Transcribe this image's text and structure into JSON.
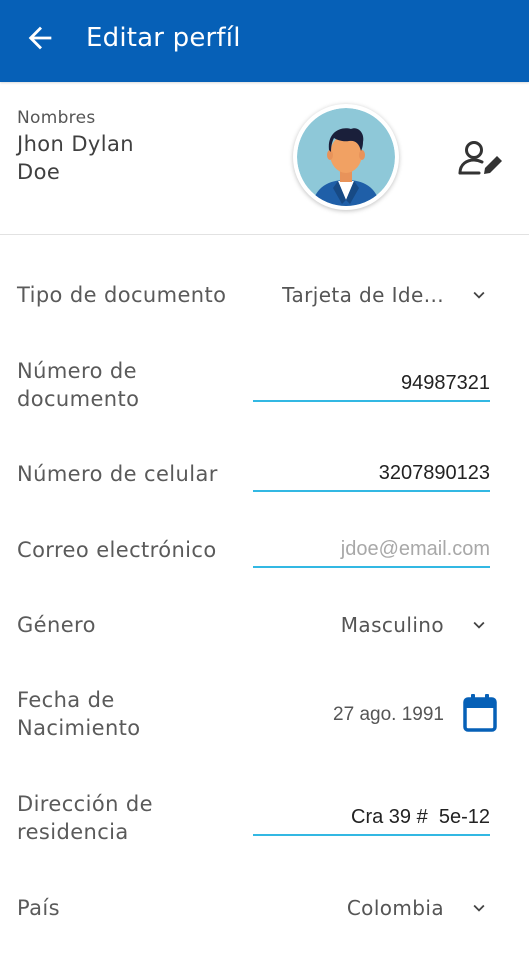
{
  "header": {
    "title": "Editar perfíl",
    "back_icon": "arrow-left-icon",
    "color": "#0660b7"
  },
  "profile": {
    "names_label": "Nombres",
    "first_line": "Jhon Dylan",
    "second_line": "Doe",
    "avatar_icon": "user-avatar-icon",
    "edit_icon": "user-edit-icon"
  },
  "form": {
    "document_type": {
      "label": "Tipo de documento",
      "value": "Tarjeta de Ide..."
    },
    "document_number": {
      "label_line1": "Número de",
      "label_line2": "documento",
      "value": "94987321"
    },
    "phone": {
      "label": "Número de celular",
      "value": "3207890123"
    },
    "email": {
      "label": "Correo electrónico",
      "value": "",
      "placeholder": "jdoe@email.com"
    },
    "gender": {
      "label": "Género",
      "value": "Masculino"
    },
    "birth_date": {
      "label_line1": "Fecha de",
      "label_line2": "Nacimiento",
      "value": "27 ago. 1991"
    },
    "address": {
      "label_line1": "Dirección de",
      "label_line2": "residencia",
      "value": "Cra 39 #  5e-12"
    },
    "country": {
      "label": "País",
      "value": "Colombia"
    }
  },
  "colors": {
    "accent": "#0660b7",
    "underline": "#33b8e3"
  }
}
